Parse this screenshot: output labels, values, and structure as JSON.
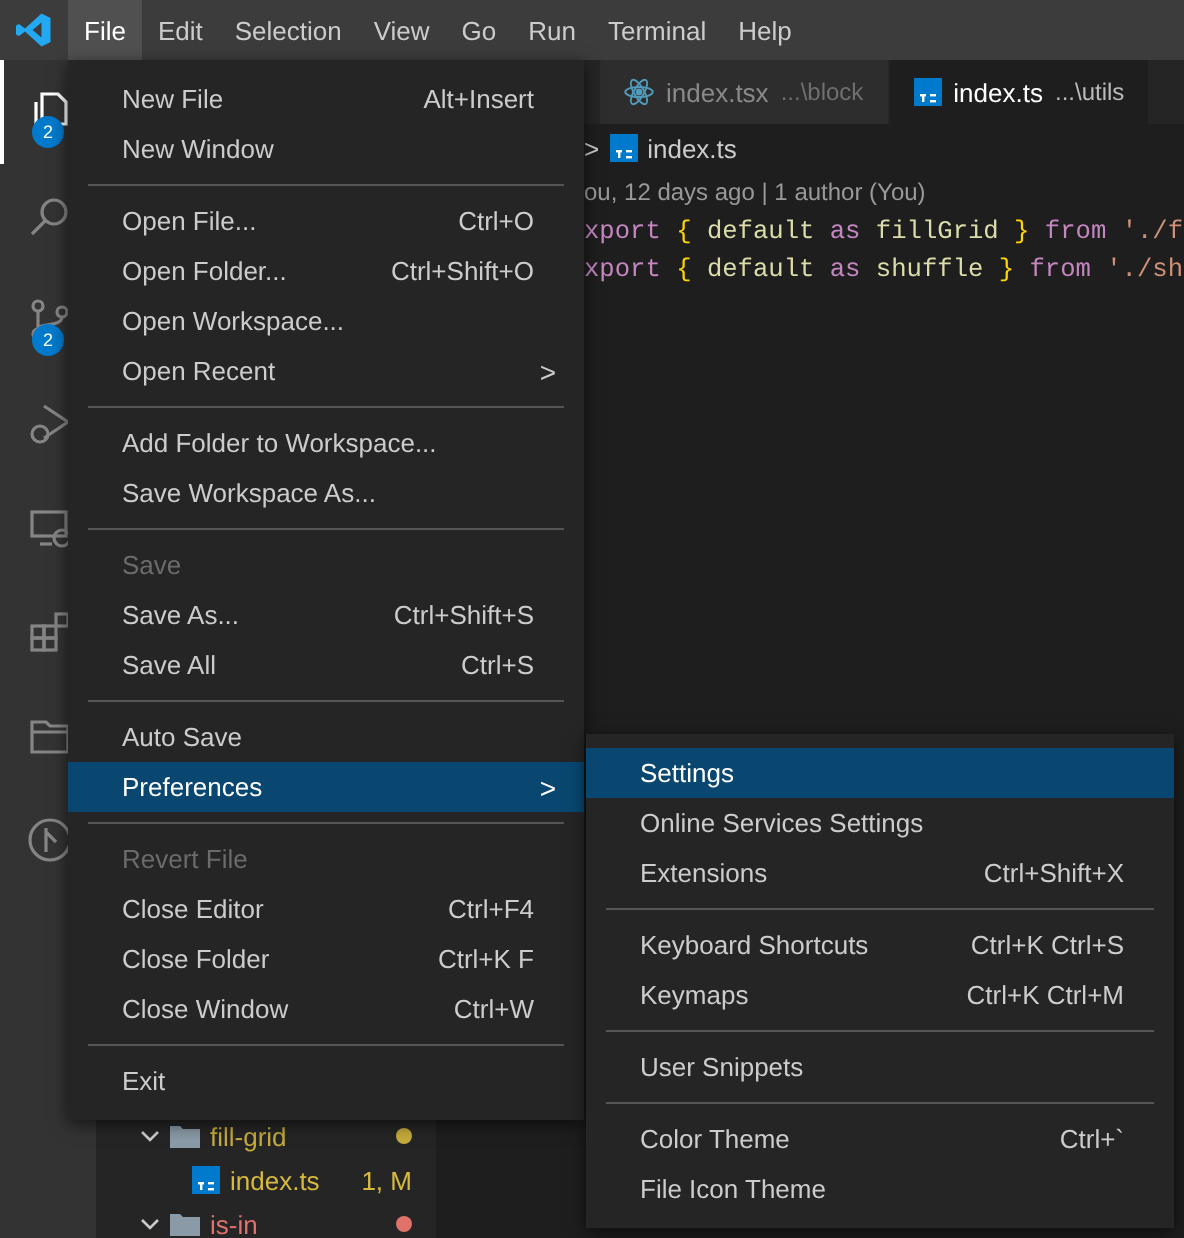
{
  "menubar": [
    {
      "label": "File",
      "selected": true
    },
    {
      "label": "Edit",
      "selected": false
    },
    {
      "label": "Selection",
      "selected": false
    },
    {
      "label": "View",
      "selected": false
    },
    {
      "label": "Go",
      "selected": false
    },
    {
      "label": "Run",
      "selected": false
    },
    {
      "label": "Terminal",
      "selected": false
    },
    {
      "label": "Help",
      "selected": false
    }
  ],
  "activity_bar": [
    {
      "kind": "files",
      "selected": true,
      "badge": "2"
    },
    {
      "kind": "search",
      "selected": false
    },
    {
      "kind": "source-control",
      "selected": false,
      "badge": "2"
    },
    {
      "kind": "debug",
      "selected": false
    },
    {
      "kind": "remote",
      "selected": false
    },
    {
      "kind": "extensions",
      "selected": false
    },
    {
      "kind": "folder",
      "selected": false
    },
    {
      "kind": "graph",
      "selected": false
    }
  ],
  "tabs": [
    {
      "kind": "tsx",
      "title": "index.tsx",
      "path": "...\\block",
      "selected": false
    },
    {
      "kind": "ts",
      "title": "index.ts",
      "path": "...\\utils",
      "selected": true
    }
  ],
  "breadcrumb": {
    "separator": ">",
    "file": "index.ts"
  },
  "codelens": "ou, 12 days ago | 1 author (You)",
  "code": [
    [
      {
        "kind": "keyword",
        "text": "xport"
      },
      {
        "kind": "brace",
        "text": " {"
      },
      {
        "kind": "ident",
        "text": " default"
      },
      {
        "kind": "keyword",
        "text": " as"
      },
      {
        "kind": "ident",
        "text": " fillGrid"
      },
      {
        "kind": "brace",
        "text": " }"
      },
      {
        "kind": "keyword",
        "text": " from"
      },
      {
        "kind": "string",
        "text": " './f"
      }
    ],
    [
      {
        "kind": "keyword",
        "text": "xport"
      },
      {
        "kind": "brace",
        "text": " {"
      },
      {
        "kind": "ident",
        "text": " default"
      },
      {
        "kind": "keyword",
        "text": " as"
      },
      {
        "kind": "ident",
        "text": " shuffle"
      },
      {
        "kind": "brace",
        "text": " }"
      },
      {
        "kind": "keyword",
        "text": " from"
      },
      {
        "kind": "string",
        "text": " './sh"
      }
    ]
  ],
  "explorer": [
    {
      "kind": "folder",
      "name": "fill-grid",
      "expanded": true,
      "color": "#c5ab3b",
      "children": [
        {
          "kind": "file",
          "name": "index.ts",
          "badge": "1, M",
          "color": "#d7ba3d"
        }
      ]
    },
    {
      "kind": "folder",
      "name": "is-in",
      "expanded": true,
      "color": "#e0716b"
    }
  ],
  "file_menu": [
    {
      "kind": "item",
      "label": "New File",
      "shortcut": "Alt+Insert",
      "disabled": false,
      "selected": false
    },
    {
      "kind": "item",
      "label": "New Window",
      "disabled": false,
      "selected": false
    },
    {
      "kind": "separator"
    },
    {
      "kind": "item",
      "label": "Open File...",
      "shortcut": "Ctrl+O",
      "disabled": false,
      "selected": false
    },
    {
      "kind": "item",
      "label": "Open Folder...",
      "shortcut": "Ctrl+Shift+O",
      "disabled": false,
      "selected": false
    },
    {
      "kind": "item",
      "label": "Open Workspace...",
      "disabled": false,
      "selected": false
    },
    {
      "kind": "submenu",
      "label": "Open Recent",
      "arrow": ">",
      "disabled": false,
      "selected": false
    },
    {
      "kind": "separator"
    },
    {
      "kind": "item",
      "label": "Add Folder to Workspace...",
      "disabled": false,
      "selected": false
    },
    {
      "kind": "item",
      "label": "Save Workspace As...",
      "disabled": false,
      "selected": false
    },
    {
      "kind": "separator"
    },
    {
      "kind": "item",
      "label": "Save",
      "disabled": true,
      "selected": false
    },
    {
      "kind": "item",
      "label": "Save As...",
      "shortcut": "Ctrl+Shift+S",
      "disabled": false,
      "selected": false
    },
    {
      "kind": "item",
      "label": "Save All",
      "shortcut": "Ctrl+S",
      "disabled": false,
      "selected": false
    },
    {
      "kind": "separator"
    },
    {
      "kind": "item",
      "label": "Auto Save",
      "disabled": false,
      "selected": false
    },
    {
      "kind": "submenu",
      "label": "Preferences",
      "arrow": ">",
      "disabled": false,
      "selected": true
    },
    {
      "kind": "separator"
    },
    {
      "kind": "item",
      "label": "Revert File",
      "disabled": true,
      "selected": false
    },
    {
      "kind": "item",
      "label": "Close Editor",
      "shortcut": "Ctrl+F4",
      "disabled": false,
      "selected": false
    },
    {
      "kind": "item",
      "label": "Close Folder",
      "shortcut": "Ctrl+K F",
      "disabled": false,
      "selected": false
    },
    {
      "kind": "item",
      "label": "Close Window",
      "shortcut": "Ctrl+W",
      "disabled": false,
      "selected": false
    },
    {
      "kind": "separator"
    },
    {
      "kind": "item",
      "label": "Exit",
      "disabled": false,
      "selected": false
    }
  ],
  "preferences_menu": [
    {
      "kind": "item",
      "label": "Settings",
      "disabled": false,
      "selected": true
    },
    {
      "kind": "item",
      "label": "Online Services Settings",
      "disabled": false,
      "selected": false
    },
    {
      "kind": "item",
      "label": "Extensions",
      "shortcut": "Ctrl+Shift+X",
      "disabled": false,
      "selected": false
    },
    {
      "kind": "separator"
    },
    {
      "kind": "item",
      "label": "Keyboard Shortcuts",
      "shortcut": "Ctrl+K Ctrl+S",
      "disabled": false,
      "selected": false
    },
    {
      "kind": "item",
      "label": "Keymaps",
      "shortcut": "Ctrl+K Ctrl+M",
      "disabled": false,
      "selected": false
    },
    {
      "kind": "separator"
    },
    {
      "kind": "item",
      "label": "User Snippets",
      "disabled": false,
      "selected": false
    },
    {
      "kind": "separator"
    },
    {
      "kind": "item",
      "label": "Color Theme",
      "shortcut": "Ctrl+`",
      "disabled": false,
      "selected": false
    },
    {
      "kind": "item",
      "label": "File Icon Theme",
      "disabled": false,
      "selected": false
    }
  ]
}
